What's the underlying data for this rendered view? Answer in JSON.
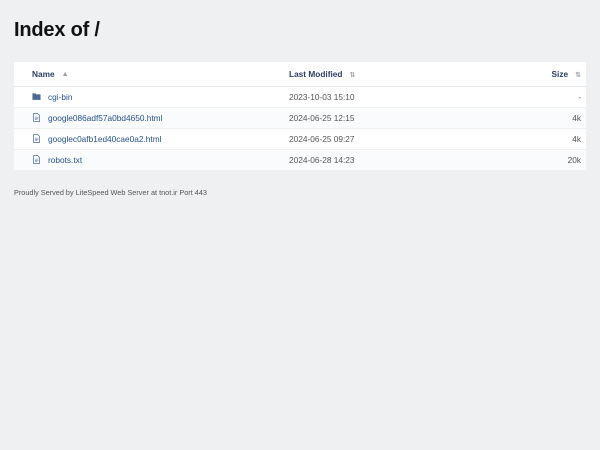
{
  "page": {
    "title": "Index of /"
  },
  "table": {
    "headers": {
      "name": "Name",
      "name_sort": "▲",
      "modified": "Last Modified",
      "modified_sort": "⇅",
      "size": "Size",
      "size_sort": "⇅"
    },
    "rows": [
      {
        "icon": "folder-icon",
        "name": "cgi-bin",
        "modified": "2023-10-03 15:10",
        "size": "-"
      },
      {
        "icon": "file-icon",
        "name": "google086adf57a0bd4650.html",
        "modified": "2024-06-25 12:15",
        "size": "4k"
      },
      {
        "icon": "file-icon",
        "name": "googlec0afb1ed40cae0a2.html",
        "modified": "2024-06-25 09:27",
        "size": "4k"
      },
      {
        "icon": "file-icon",
        "name": "robots.txt",
        "modified": "2024-06-28 14:23",
        "size": "20k"
      }
    ]
  },
  "footer": {
    "text": "Proudly Served by LiteSpeed Web Server at tnot.ir Port 443"
  },
  "colors": {
    "background": "#eff0f2",
    "link": "#24508a",
    "header_text": "#2c3e66",
    "icon": "#4a6a94"
  }
}
